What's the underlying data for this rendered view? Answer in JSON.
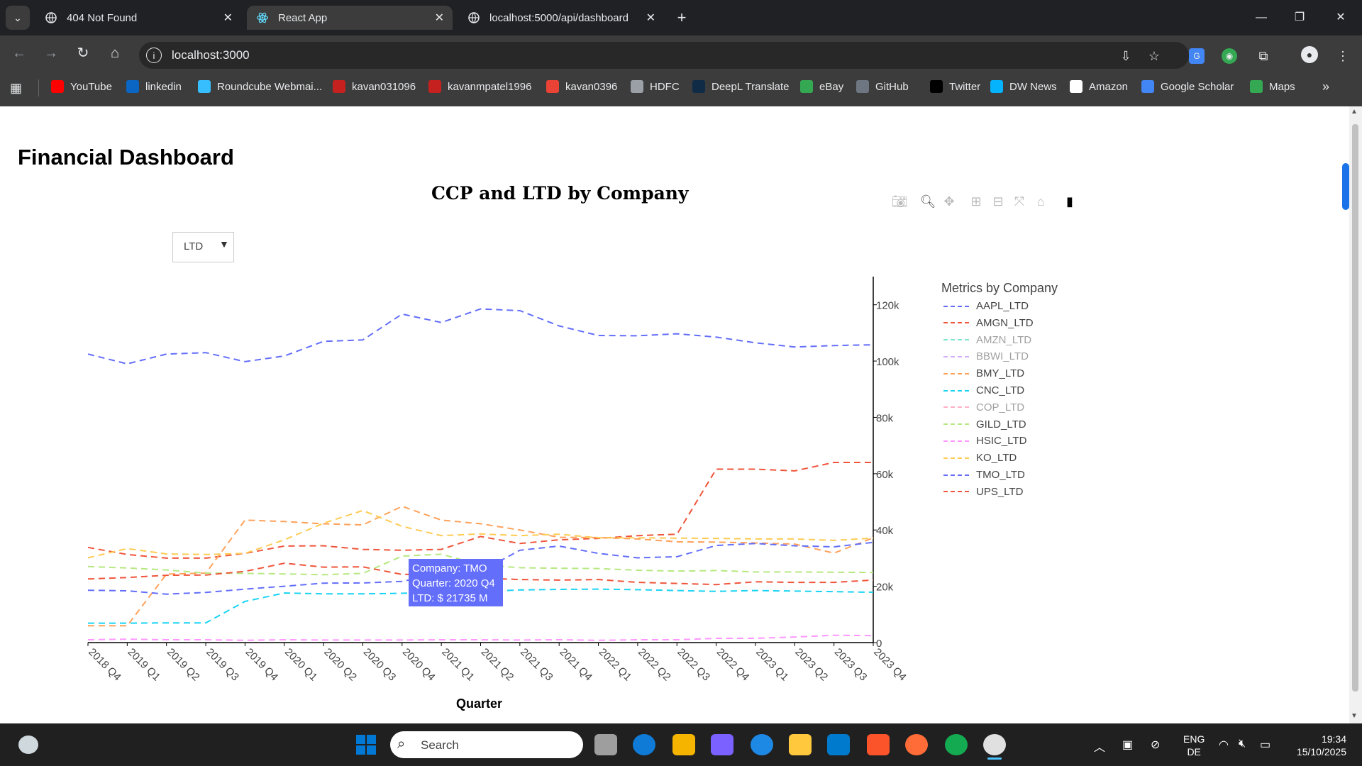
{
  "browser": {
    "tabs": [
      {
        "title": "404 Not Found",
        "active": false
      },
      {
        "title": "React App",
        "active": true
      },
      {
        "title": "localhost:5000/api/dashboard",
        "active": false
      }
    ],
    "url": "localhost:3000",
    "bookmarks": [
      {
        "label": "YouTube",
        "icon": "youtube-icon",
        "color": "#ff0000"
      },
      {
        "label": "linkedin",
        "icon": "linkedin-icon",
        "color": "#0a66c2"
      },
      {
        "label": "Roundcube Webmai...",
        "icon": "roundcube-icon",
        "color": "#37beff"
      },
      {
        "label": "kavan031096",
        "icon": "gmail-icon",
        "color": "#c5221f"
      },
      {
        "label": "kavanmpatel1996",
        "icon": "gmail-icon",
        "color": "#c5221f"
      },
      {
        "label": "kavan0396",
        "icon": "gmail-icon",
        "color": "#ea4335"
      },
      {
        "label": "HDFC",
        "icon": "globe-icon",
        "color": "#9aa0a6"
      },
      {
        "label": "DeepL Translate",
        "icon": "deepl-icon",
        "color": "#0f2b46"
      },
      {
        "label": "eBay",
        "icon": "ebay-icon",
        "color": "#34a853"
      },
      {
        "label": "GitHub",
        "icon": "github-icon",
        "color": "#6e7681"
      },
      {
        "label": "Twitter",
        "icon": "x-icon",
        "color": "#000000"
      },
      {
        "label": "DW News",
        "icon": "dw-icon",
        "color": "#05b2fc"
      },
      {
        "label": "Amazon",
        "icon": "amazon-icon",
        "color": "#ffffff"
      },
      {
        "label": "Google Scholar",
        "icon": "scholar-icon",
        "color": "#4285f4"
      },
      {
        "label": "Maps",
        "icon": "maps-icon",
        "color": "#34a853"
      }
    ]
  },
  "page": {
    "title": "Financial Dashboard",
    "dropdown_value": "LTD",
    "tooltip": {
      "line1": "Company: TMO",
      "line2": "Quarter: 2020 Q4",
      "line3": "LTD: $ 21735 M"
    }
  },
  "chart_data": {
    "type": "line",
    "title": "CCP and LTD by Company",
    "xlabel": "Quarter",
    "ylabel": "",
    "ylim": [
      0,
      130000
    ],
    "yticks": [
      0,
      20000,
      40000,
      60000,
      80000,
      100000,
      120000
    ],
    "ytick_labels": [
      "0",
      "20k",
      "40k",
      "60k",
      "80k",
      "100k",
      "120k"
    ],
    "y_axis_side": "right",
    "legend_title": "Metrics by Company",
    "legend_placement": "right",
    "categories": [
      "2018 Q4",
      "2019 Q1",
      "2019 Q2",
      "2019 Q3",
      "2019 Q4",
      "2020 Q1",
      "2020 Q2",
      "2020 Q3",
      "2020 Q4",
      "2021 Q1",
      "2021 Q2",
      "2021 Q3",
      "2021 Q4",
      "2022 Q1",
      "2022 Q2",
      "2022 Q3",
      "2022 Q4",
      "2023 Q1",
      "2023 Q2",
      "2023 Q3",
      "2023 Q4"
    ],
    "series": [
      {
        "name": "AAPL_LTD",
        "color": "#636efa",
        "values": [
          102500,
          99000,
          102500,
          103000,
          99800,
          101800,
          107000,
          107500,
          116700,
          113700,
          118500,
          117900,
          112500,
          109100,
          109000,
          109700,
          108500,
          106500,
          105000,
          105500,
          105800
        ]
      },
      {
        "name": "AMGN_LTD",
        "color": "#ef553b",
        "values": [
          33800,
          31300,
          30000,
          30000,
          31700,
          34300,
          34400,
          33100,
          32800,
          33100,
          37700,
          35200,
          36500,
          37000,
          38000,
          38500,
          61600,
          61600,
          61000,
          64000,
          64000
        ]
      },
      {
        "name": "AMZN_LTD",
        "color": "#00cc96",
        "hidden": true,
        "values": []
      },
      {
        "name": "BBWI_LTD",
        "color": "#ab63fa",
        "hidden": true,
        "values": []
      },
      {
        "name": "BMY_LTD",
        "color": "#ffa15a",
        "values": [
          6000,
          6000,
          24300,
          24700,
          43500,
          43000,
          42200,
          41800,
          48400,
          43500,
          42200,
          40000,
          37400,
          37300,
          36800,
          35800,
          35700,
          35400,
          35000,
          31800,
          37200
        ]
      },
      {
        "name": "CNC_LTD",
        "color": "#19d3f3",
        "values": [
          6900,
          6900,
          7000,
          7000,
          14600,
          17600,
          17300,
          17300,
          17500,
          17900,
          18200,
          18700,
          18900,
          19000,
          18800,
          18500,
          18200,
          18500,
          18300,
          18100,
          17900
        ]
      },
      {
        "name": "COP_LTD",
        "color": "#ff6692",
        "hidden": true,
        "values": []
      },
      {
        "name": "GILD_LTD",
        "color": "#b6e880",
        "values": [
          27000,
          26500,
          25800,
          24700,
          24600,
          24400,
          24100,
          24600,
          30700,
          31400,
          27600,
          26600,
          26400,
          26300,
          25700,
          25400,
          25600,
          25100,
          25100,
          25000,
          24900
        ]
      },
      {
        "name": "HSIC_LTD",
        "color": "#ff97ff",
        "values": [
          1000,
          1200,
          1000,
          1000,
          800,
          1000,
          900,
          900,
          900,
          1000,
          1000,
          900,
          1000,
          800,
          1000,
          1000,
          1500,
          1500,
          2000,
          2600,
          2500
        ]
      },
      {
        "name": "KO_LTD",
        "color": "#fecb52",
        "values": [
          30100,
          33400,
          31500,
          31300,
          31700,
          36500,
          42400,
          46900,
          41300,
          38000,
          38600,
          38000,
          38500,
          37200,
          37200,
          37100,
          37000,
          36800,
          36800,
          36300,
          37100
        ]
      },
      {
        "name": "TMO_LTD",
        "color": "#636efa",
        "values": [
          18600,
          18400,
          17200,
          17800,
          19000,
          20000,
          21100,
          21200,
          21735,
          24500,
          25300,
          32800,
          34300,
          31700,
          30100,
          30500,
          34500,
          35200,
          34400,
          34000,
          35600
        ]
      },
      {
        "name": "UPS_LTD",
        "color": "#ef553b",
        "values": [
          22600,
          23100,
          23900,
          24000,
          25300,
          28200,
          26800,
          26900,
          24200,
          24400,
          22900,
          22400,
          22200,
          22400,
          21400,
          21000,
          20600,
          21600,
          21400,
          21400,
          22200
        ]
      }
    ]
  },
  "taskbar": {
    "search_label": "Search",
    "lang_line1": "ENG",
    "lang_line2": "DE",
    "time": "19:34",
    "date": "15/10/2025"
  }
}
